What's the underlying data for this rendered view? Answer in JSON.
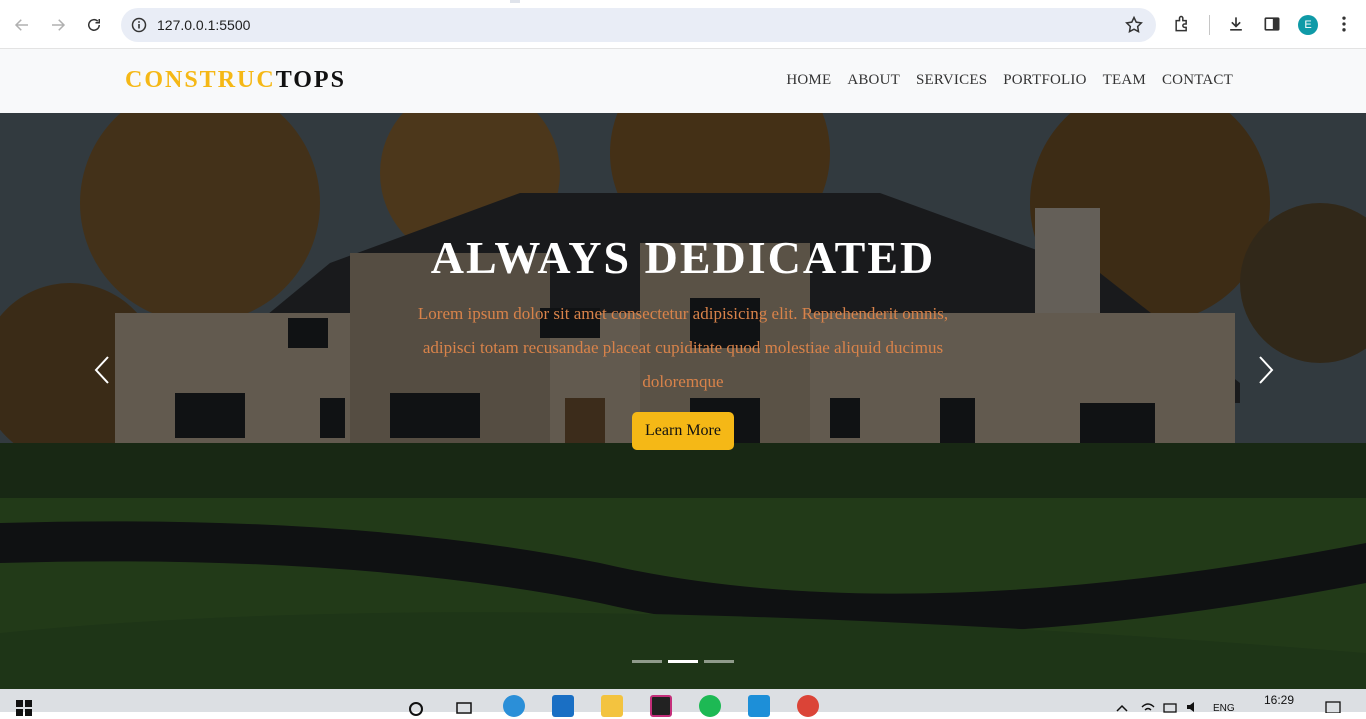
{
  "browser": {
    "url": "127.0.0.1:5500",
    "profile_initial": "E"
  },
  "site": {
    "logo_part1": "CONSTRUC",
    "logo_part2": "TOPS",
    "nav": [
      "HOME",
      "ABOUT",
      "SERVICES",
      "PORTFOLIO",
      "TEAM",
      "CONTACT"
    ]
  },
  "hero": {
    "title": "ALWAYS DEDICATED",
    "text": "Lorem ipsum dolor sit amet consectetur adipisicing elit. Reprehenderit omnis, adipisci totam recusandae placeat cupiditate quod molestiae aliquid ducimus doloremque",
    "button_label": "Learn More",
    "active_slide": 2,
    "slide_count": 3
  },
  "taskbar": {
    "language": "ENG",
    "time": "16:29"
  },
  "colors": {
    "accent": "#f5b816",
    "hero_text": "#d9834a"
  }
}
